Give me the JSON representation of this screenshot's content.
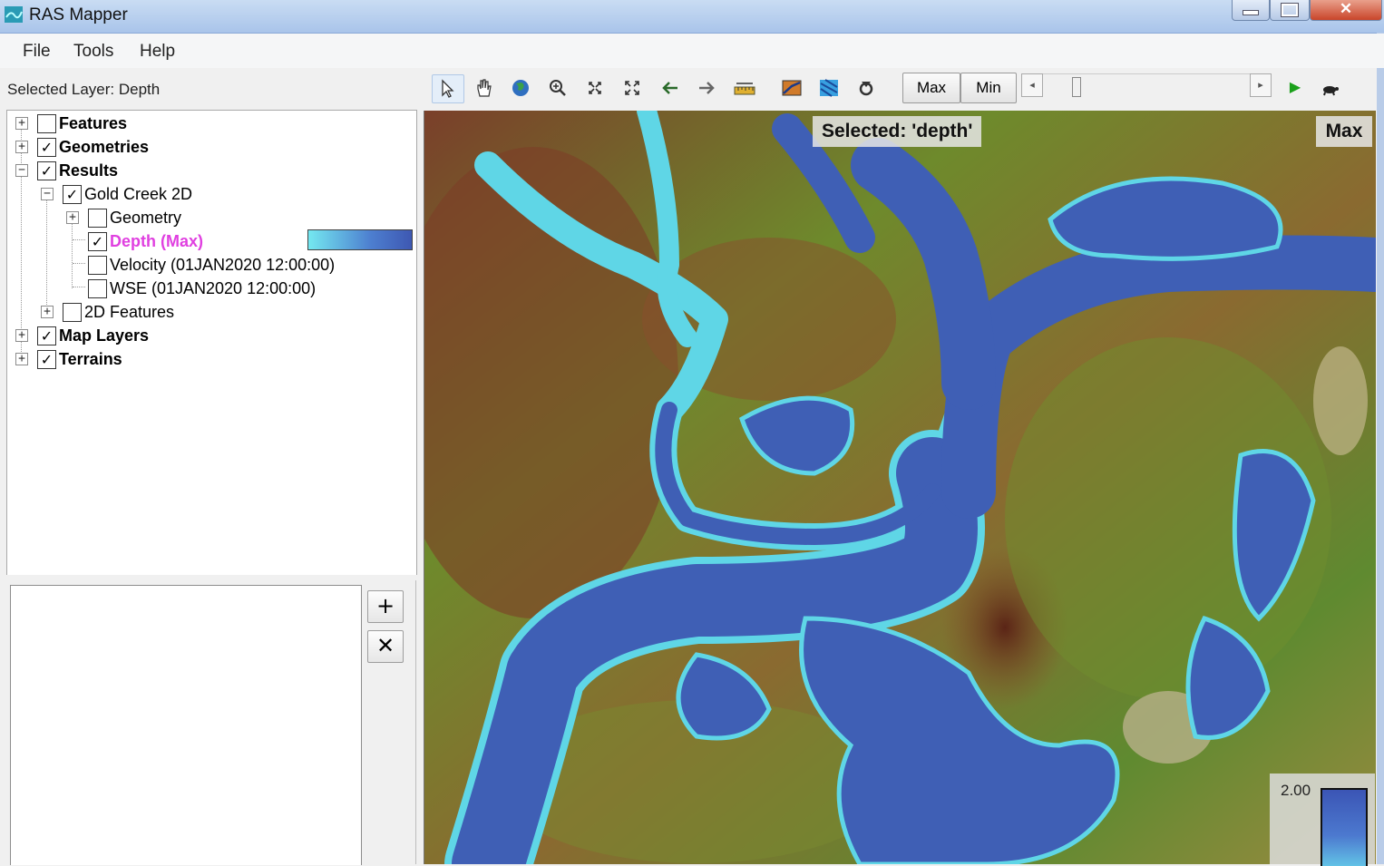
{
  "window": {
    "title": "RAS Mapper",
    "close_glyph": "✕"
  },
  "menu": [
    "File",
    "Tools",
    "Help"
  ],
  "selected_layer_text": "Selected Layer: Depth",
  "toolbar": {
    "icons": [
      "pointer-icon",
      "pan-hand-icon",
      "globe-icon",
      "zoom-in-icon",
      "zoom-extents-icon",
      "full-extent-icon",
      "back-arrow-icon",
      "forward-arrow-icon",
      "measure-ruler-icon",
      "profile-line-icon",
      "raster-map-icon",
      "plot-icon"
    ],
    "max_label": "Max",
    "min_label": "Min",
    "slider_prev_glyph": "◂",
    "slider_next_glyph": "▸",
    "play_glyph": "▶"
  },
  "tree": [
    {
      "label": "Features",
      "checked": false,
      "bold": true,
      "expander": "+"
    },
    {
      "label": "Geometries",
      "checked": true,
      "bold": true,
      "expander": "+"
    },
    {
      "label": "Results",
      "checked": true,
      "bold": true,
      "expander": "−"
    },
    {
      "label": "Gold Creek 2D",
      "checked": true,
      "bold": false,
      "expander": "−"
    },
    {
      "label": "Geometry",
      "checked": false,
      "bold": false,
      "expander": "+"
    },
    {
      "label": "Depth (Max)",
      "checked": true,
      "bold": true,
      "highlight_color": "#e040e0"
    },
    {
      "label": "Velocity (01JAN2020 12:00:00)",
      "checked": false,
      "bold": false
    },
    {
      "label": "WSE (01JAN2020 12:00:00)",
      "checked": false,
      "bold": false
    },
    {
      "label": "2D Features",
      "checked": false,
      "bold": false,
      "expander": "+"
    },
    {
      "label": "Map Layers",
      "checked": true,
      "bold": true,
      "expander": "+"
    },
    {
      "label": "Terrains",
      "checked": true,
      "bold": true,
      "expander": "+"
    }
  ],
  "side_buttons": {
    "add": "+",
    "remove": "✕"
  },
  "map": {
    "selected_text": "Selected: 'depth'",
    "mode_text": "Max",
    "legend_max_value": "2.00",
    "colors": {
      "water": "#3f5fb5",
      "shallow": "#5fd6e6",
      "terrain_low": "#5b8a2e",
      "terrain_high": "#8a4a2a"
    }
  },
  "check_glyph": "✓"
}
